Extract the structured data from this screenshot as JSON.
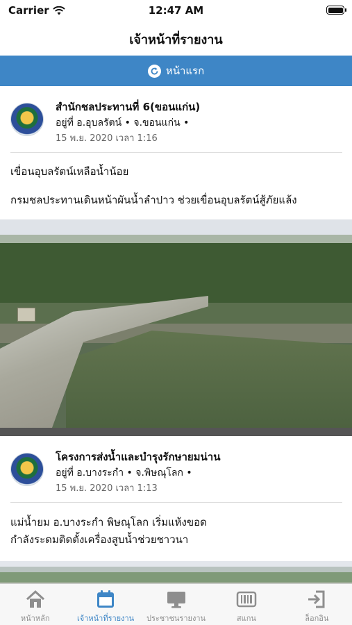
{
  "status_bar": {
    "carrier": "Carrier",
    "time": "12:47 AM"
  },
  "nav": {
    "title": "เจ้าหน้าที่รายงาน"
  },
  "home_banner": {
    "label": "หน้าแรก",
    "icon": "refresh-icon"
  },
  "posts": [
    {
      "author": "สำนักชลประทานที่ 6(ขอนแก่น)",
      "location": "อยู่ที่  อ.อุบลรัตน์  • จ.ขอนแก่น •",
      "time": "15 พ.ย. 2020 เวลา 1:16",
      "body": [
        "เขื่อนอุบลรัตน์เหลือน้ำน้อย",
        "กรมชลประทานเดินหน้าผันน้ำลำปาว ช่วยเขื่อนอุบลรัตน์สู้ภัยแล้ง"
      ]
    },
    {
      "author": "โครงการส่งน้ำและบำรุงรักษายมน่าน",
      "location": "อยู่ที่  อ.บางระกำ  • จ.พิษณุโลก •",
      "time": "15 พ.ย. 2020 เวลา 1:13",
      "body": [
        "แม่น้ำยม อ.บางระกำ พิษณุโลก เริ่มแห้งขอด",
        "กำลังระดมติดตั้งเครื่องสูบน้ำช่วยชาวนา"
      ]
    }
  ],
  "tabs": [
    {
      "label": "หน้าหลัก",
      "icon": "home-icon",
      "active": false
    },
    {
      "label": "เจ้าหน้าที่รายงาน",
      "icon": "calendar-icon",
      "active": true
    },
    {
      "label": "ประชาชนรายงาน",
      "icon": "monitor-icon",
      "active": false
    },
    {
      "label": "สแกน",
      "icon": "barcode-icon",
      "active": false
    },
    {
      "label": "ล็อกอิน",
      "icon": "login-icon",
      "active": false
    }
  ],
  "colors": {
    "accent": "#3e86c6",
    "tab_inactive": "#8e8e8e"
  }
}
